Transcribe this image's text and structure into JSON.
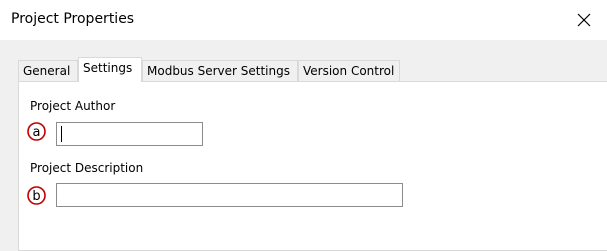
{
  "window": {
    "title": "Project Properties",
    "close_icon": "close-icon"
  },
  "tabs": [
    {
      "label": "General",
      "active": false
    },
    {
      "label": "Settings",
      "active": true
    },
    {
      "label": "Modbus Server Settings",
      "active": false
    },
    {
      "label": "Version Control",
      "active": false
    }
  ],
  "form": {
    "author": {
      "label": "Project Author",
      "value": "",
      "callout": "a"
    },
    "description": {
      "label": "Project Description",
      "value": "",
      "callout": "b"
    }
  },
  "colors": {
    "callout_stroke": "#c00000",
    "window_bg": "#f0f0f0",
    "panel_bg": "#ffffff"
  }
}
